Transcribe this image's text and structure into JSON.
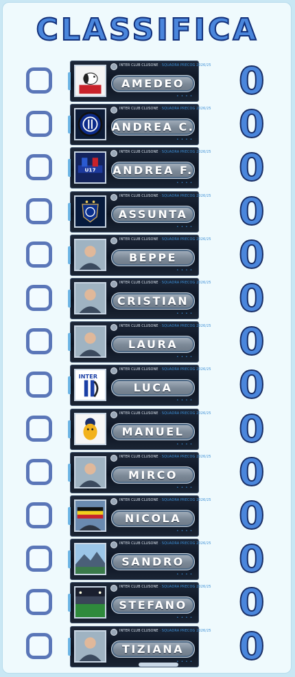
{
  "title": "CLASSIFICA",
  "club_label": "INTER CLUB CLUSONE",
  "club_sub": "SQUADRA PRECOG 2026/25",
  "colors": {
    "score": "#4a86dc",
    "marker": "#5a76b8",
    "card": "#0c1422",
    "accent": "#3d8fd6"
  },
  "rows": [
    {
      "name": "AMEDEO",
      "score": "0",
      "avatar": "snoopy-avatar"
    },
    {
      "name": "ANDREA C.",
      "score": "0",
      "avatar": "inter-logo-avatar"
    },
    {
      "name": "ANDREA F.",
      "score": "0",
      "avatar": "under17-avatar"
    },
    {
      "name": "ASSUNTA",
      "score": "0",
      "avatar": "inter-badge-avatar"
    },
    {
      "name": "BEPPE",
      "score": "0",
      "avatar": "person-avatar"
    },
    {
      "name": "CRISTIAN",
      "score": "0",
      "avatar": "person-avatar"
    },
    {
      "name": "LAURA",
      "score": "0",
      "avatar": "person-avatar"
    },
    {
      "name": "LUCA",
      "score": "0",
      "avatar": "inter-vintage-avatar"
    },
    {
      "name": "MANUEL",
      "score": "0",
      "avatar": "mascot-avatar"
    },
    {
      "name": "MIRCO",
      "score": "0",
      "avatar": "person-avatar"
    },
    {
      "name": "NICOLA",
      "score": "0",
      "avatar": "flag-avatar"
    },
    {
      "name": "SANDRO",
      "score": "0",
      "avatar": "mountain-avatar"
    },
    {
      "name": "STEFANO",
      "score": "0",
      "avatar": "stadium-avatar"
    },
    {
      "name": "TIZIANA",
      "score": "0",
      "avatar": "person-avatar"
    }
  ]
}
